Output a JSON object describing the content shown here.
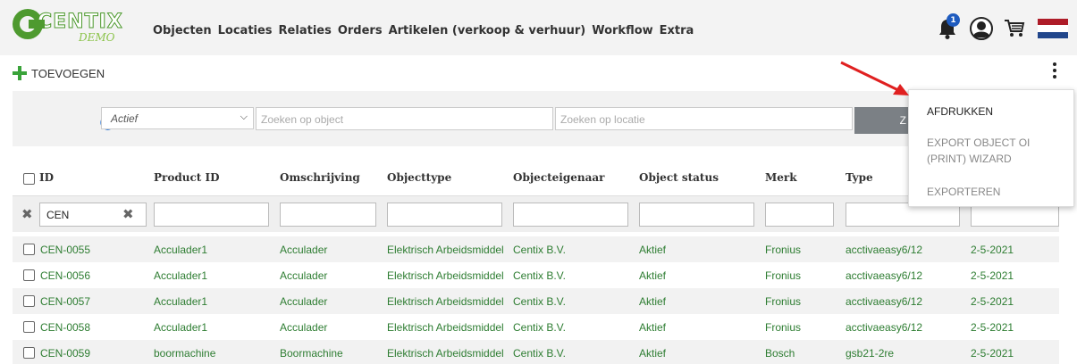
{
  "app": {
    "logo_text": "CENTIX",
    "logo_sub": "DEMO"
  },
  "nav": {
    "items": [
      "Objecten",
      "Locaties",
      "Relaties",
      "Orders",
      "Artikelen (verkoop & verhuur)",
      "Workflow",
      "Extra"
    ]
  },
  "header_icons": {
    "notification_count": "1",
    "icons": [
      "bell-icon",
      "avatar-icon",
      "cart-icon",
      "flag-nl-icon"
    ],
    "flag_colors": [
      "#ae1c28",
      "#ffffff",
      "#21468b"
    ]
  },
  "toolbar": {
    "add_label": "TOEVOEGEN"
  },
  "filters": {
    "status_value": "Actief",
    "object_placeholder": "Zoeken op object",
    "location_placeholder": "Zoeken op locatie",
    "search_button_partial": "Z"
  },
  "menu": {
    "items": [
      "AFDRUKKEN",
      "EXPORT OBJECT OI (PRINT) WIZARD",
      "EXPORTEREN"
    ]
  },
  "table": {
    "headers": [
      "ID",
      "Product ID",
      "Omschrijving",
      "Objecttype",
      "Objecteigenaar",
      "Object status",
      "Merk",
      "Type"
    ],
    "id_filter_value": "CEN",
    "rows": [
      [
        "CEN-0055",
        "Acculader1",
        "Acculader",
        "Elektrisch Arbeidsmiddel",
        "Centix B.V.",
        "Aktief",
        "Fronius",
        "acctivaeasy6/12",
        "2-5-2021"
      ],
      [
        "CEN-0056",
        "Acculader1",
        "Acculader",
        "Elektrisch Arbeidsmiddel",
        "Centix B.V.",
        "Aktief",
        "Fronius",
        "acctivaeasy6/12",
        "2-5-2021"
      ],
      [
        "CEN-0057",
        "Acculader1",
        "Acculader",
        "Elektrisch Arbeidsmiddel",
        "Centix B.V.",
        "Aktief",
        "Fronius",
        "acctivaeasy6/12",
        "2-5-2021"
      ],
      [
        "CEN-0058",
        "Acculader1",
        "Acculader",
        "Elektrisch Arbeidsmiddel",
        "Centix B.V.",
        "Aktief",
        "Fronius",
        "acctivaeasy6/12",
        "2-5-2021"
      ],
      [
        "CEN-0059",
        "boormachine",
        "Boormachine",
        "Elektrisch Arbeidsmiddel",
        "Centix B.V.",
        "Aktief",
        "Bosch",
        "gsb21-2re",
        "2-5-2021"
      ]
    ]
  },
  "colors": {
    "accent_green": "#2e7d32",
    "logo_green": "#4e9a2f",
    "arrow_red": "#e02020",
    "badge_blue": "#1e5bbf"
  }
}
